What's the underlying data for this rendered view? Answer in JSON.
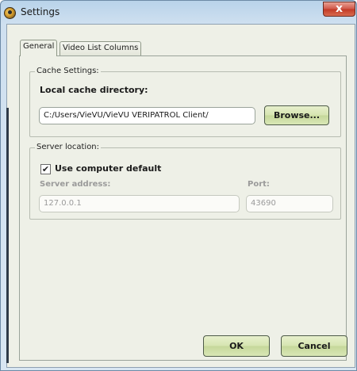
{
  "window": {
    "title": "Settings",
    "close_label": "x"
  },
  "tabs": [
    {
      "label": "General",
      "active": true
    },
    {
      "label": "Video List Columns",
      "active": false
    }
  ],
  "cache_settings": {
    "legend": "Cache Settings:",
    "label": "Local cache directory:",
    "path_value": "C:/Users/VieVU/VieVU VERIPATROL Client/",
    "browse_label": "Browse..."
  },
  "server_location": {
    "legend": "Server location:",
    "use_default_label": "Use computer default",
    "use_default_checked": true,
    "checkmark": "✔",
    "address_label": "Server address:",
    "address_value": "127.0.0.1",
    "port_label": "Port:",
    "port_value": "43690"
  },
  "buttons": {
    "ok_label": "OK",
    "cancel_label": "Cancel"
  },
  "colors": {
    "accent_button": "#d6e4b0",
    "client_bg": "#eef0e7",
    "title_bar": "#cfe0f0",
    "close": "#c23a26"
  },
  "icons": {
    "app": "settings-app-icon",
    "close": "close-icon",
    "check": "checkmark-icon"
  }
}
